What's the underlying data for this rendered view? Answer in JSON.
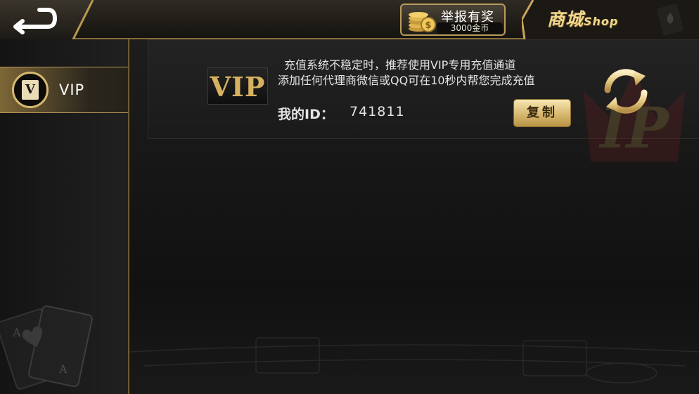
{
  "header": {
    "back_icon": "back-arrow-icon",
    "report": {
      "title": "举报有奖",
      "reward": "3000金币",
      "icon": "gold-coins-icon"
    },
    "shop": {
      "title_cn": "商城",
      "title_en": "Shop"
    }
  },
  "sidebar": {
    "items": [
      {
        "label": "VIP",
        "badge_letter": "V",
        "selected": true
      }
    ]
  },
  "vip_panel": {
    "logo_text": "VIP",
    "notice_line1": "充值系统不稳定时，推荐使用VIP专用充值通道",
    "notice_line2": "添加任何代理商微信或QQ可在10秒内帮您完成充值",
    "id_label": "我的ID：",
    "id_value": "741811",
    "copy_label": "复制",
    "refresh_icon": "refresh-icon"
  },
  "colors": {
    "gold_accent": "#d7b970",
    "background": "#1a1a1a",
    "button_gold": "#d3b36a"
  }
}
